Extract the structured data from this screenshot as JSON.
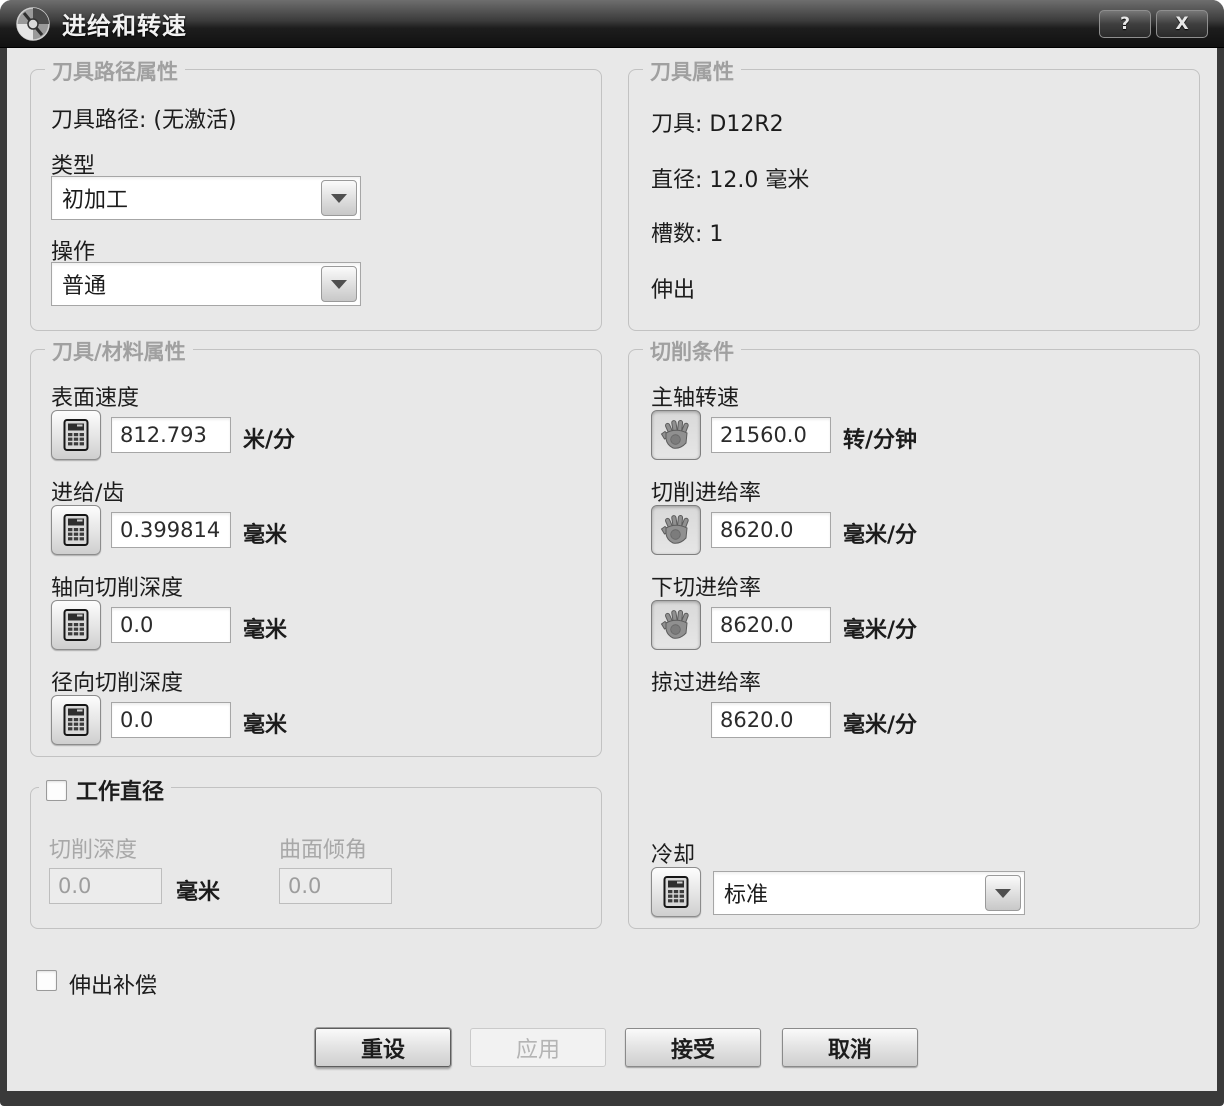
{
  "window": {
    "title": "进给和转速",
    "help_label": "?",
    "close_label": "X",
    "icon": "milling-tool-icon"
  },
  "colors": {
    "frame": "#3a3a3a",
    "client_bg": "#e8e8e8",
    "group_border": "#c2c2c2",
    "legend_text": "#a0a0a0",
    "text": "#1c1c1c",
    "disabled_text": "#9d9d9d"
  },
  "toolpath_group": {
    "legend": "刀具路径属性",
    "toolpath_status": "刀具路径: (无激活)",
    "type_label": "类型",
    "type_value": "初加工",
    "operation_label": "操作",
    "operation_value": "普通"
  },
  "tool_group": {
    "legend": "刀具属性",
    "tool": "刀具: D12R2",
    "diameter": "直径: 12.0 毫米",
    "flutes": "槽数: 1",
    "stickout": "伸出"
  },
  "tool_material_group": {
    "legend": "刀具/材料属性",
    "rows": [
      {
        "label": "表面速度",
        "value": "812.793",
        "unit": "米/分",
        "icon": "calculator-icon"
      },
      {
        "label": "进给/齿",
        "value": "0.399814",
        "unit": "毫米",
        "icon": "calculator-icon"
      },
      {
        "label": "轴向切削深度",
        "value": "0.0",
        "unit": "毫米",
        "icon": "calculator-icon"
      },
      {
        "label": "径向切削深度",
        "value": "0.0",
        "unit": "毫米",
        "icon": "calculator-icon"
      }
    ]
  },
  "cutting_group": {
    "legend": "切削条件",
    "rows": [
      {
        "label": "主轴转速",
        "value": "21560.0",
        "unit": "转/分钟",
        "icon": "hand-icon"
      },
      {
        "label": "切削进给率",
        "value": "8620.0",
        "unit": "毫米/分",
        "icon": "hand-icon"
      },
      {
        "label": "下切进给率",
        "value": "8620.0",
        "unit": "毫米/分",
        "icon": "hand-icon"
      },
      {
        "label": "掠过进给率",
        "value": "8620.0",
        "unit": "毫米/分",
        "icon": "none"
      }
    ],
    "coolant_label": "冷却",
    "coolant_value": "标准",
    "coolant_icon": "calculator-icon"
  },
  "working_diameter_group": {
    "legend": "工作直径",
    "checked": false,
    "cut_depth_label": "切削深度",
    "cut_depth_value": "0.0",
    "cut_depth_unit": "毫米",
    "surface_angle_label": "曲面倾角",
    "surface_angle_value": "0.0"
  },
  "stickout_comp": {
    "label": "伸出补偿",
    "checked": false
  },
  "buttons": {
    "reset": "重设",
    "apply": "应用",
    "accept": "接受",
    "cancel": "取消"
  }
}
